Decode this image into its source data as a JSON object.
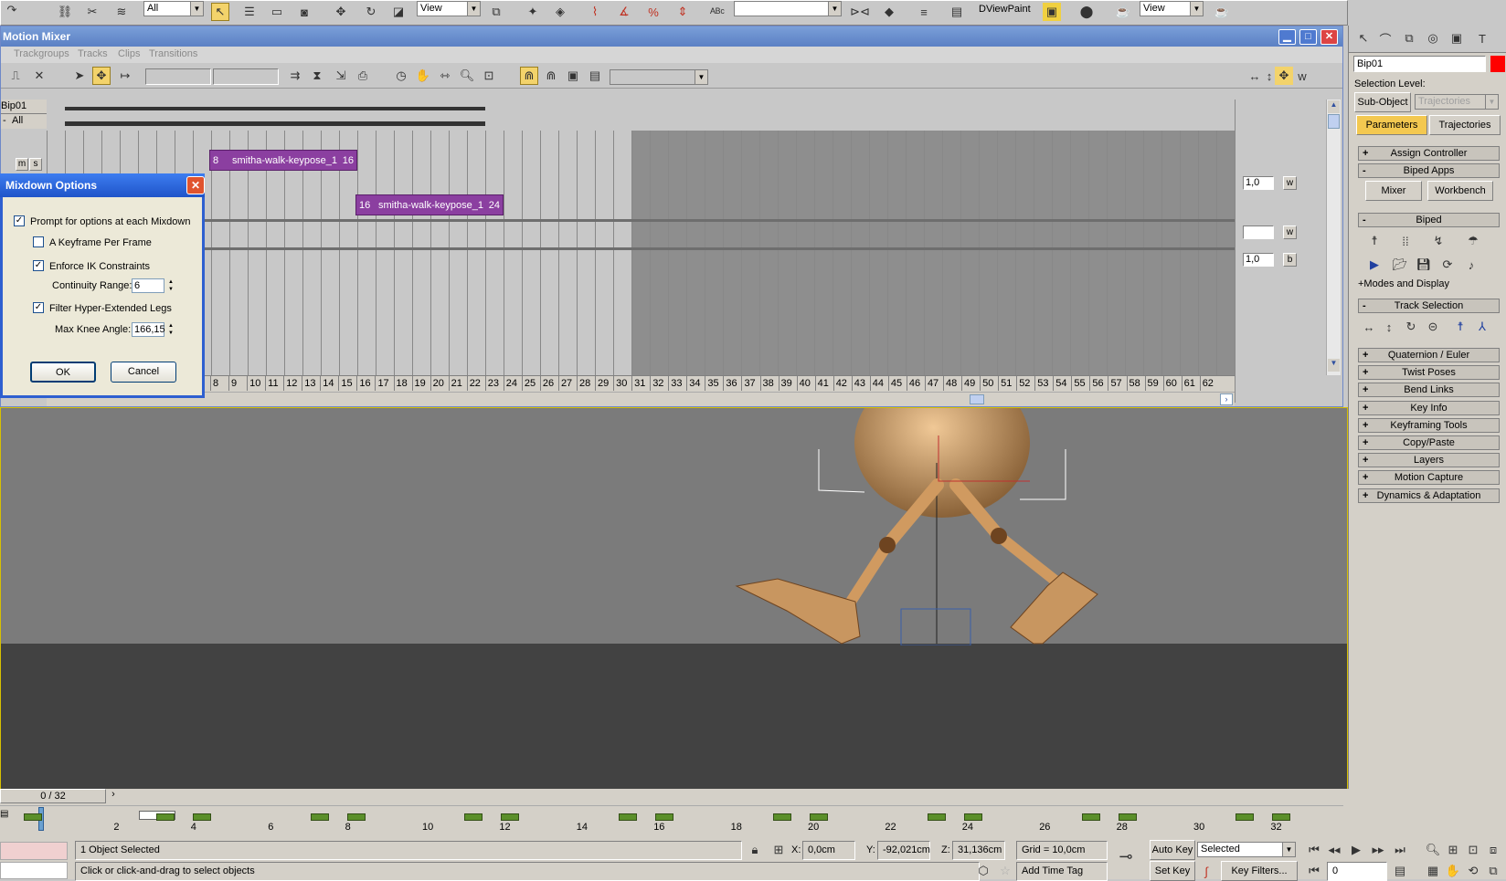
{
  "main_toolbar": {
    "selection_filter": "All",
    "view_dropdown_1": "View",
    "viewport_shading": "DViewPaint",
    "view_dropdown_2": "View"
  },
  "mixer": {
    "title": "Motion Mixer",
    "menu": [
      "Trackgroups",
      "Tracks",
      "Clips",
      "Transitions"
    ],
    "tracks": {
      "bip_label": "Bip01",
      "all_label": "All",
      "m_label": "m",
      "s_label": "s"
    },
    "clips": [
      {
        "start": "8",
        "name": "smitha-walk-keypose_1",
        "end": "16"
      },
      {
        "start": "16",
        "name": "smitha-walk-keypose_1",
        "end": "24"
      }
    ],
    "weights": [
      {
        "value": "1,0",
        "btn": "w"
      },
      {
        "value": "",
        "btn": "w"
      },
      {
        "value": "1,0",
        "btn": "b"
      }
    ],
    "ruler": [
      "8",
      "9",
      "10",
      "11",
      "12",
      "13",
      "14",
      "15",
      "16",
      "17",
      "18",
      "19",
      "20",
      "21",
      "22",
      "23",
      "24",
      "25",
      "26",
      "27",
      "28",
      "29",
      "30",
      "31",
      "32",
      "33",
      "34",
      "35",
      "36",
      "37",
      "38",
      "39",
      "40",
      "41",
      "42",
      "43",
      "44",
      "45",
      "46",
      "47",
      "48",
      "49",
      "50",
      "51",
      "52",
      "53",
      "54",
      "55",
      "56",
      "57",
      "58",
      "59",
      "60",
      "61",
      "62"
    ]
  },
  "dialog": {
    "title": "Mixdown Options",
    "prompt_label": "Prompt for options at each Mixdown",
    "keyframe_label": "A Keyframe Per Frame",
    "enforce_label": "Enforce IK Constraints",
    "continuity_label": "Continuity Range:",
    "continuity_value": "6",
    "filter_label": "Filter Hyper-Extended Legs",
    "knee_label": "Max Knee Angle:",
    "knee_value": "166,15",
    "ok_label": "OK",
    "cancel_label": "Cancel"
  },
  "command_panel": {
    "object_name": "Bip01",
    "object_color": "#ff0000",
    "selection_level_label": "Selection Level:",
    "sub_object_label": "Sub-Object",
    "trajectories_dropdown": "Trajectories",
    "tabs": [
      "Parameters",
      "Trajectories"
    ],
    "rollouts_top": [
      {
        "sign": "+",
        "label": "Assign Controller"
      },
      {
        "sign": "-",
        "label": "Biped Apps"
      }
    ],
    "biped_apps_buttons": [
      "Mixer",
      "Workbench"
    ],
    "biped_rollout": {
      "sign": "-",
      "label": "Biped"
    },
    "modes_label": "+Modes and Display",
    "track_selection": {
      "sign": "-",
      "label": "Track Selection"
    },
    "rollouts_bottom": [
      {
        "sign": "+",
        "label": "Quaternion / Euler"
      },
      {
        "sign": "+",
        "label": "Twist Poses"
      },
      {
        "sign": "+",
        "label": "Bend Links"
      },
      {
        "sign": "+",
        "label": "Key Info"
      },
      {
        "sign": "+",
        "label": "Keyframing Tools"
      },
      {
        "sign": "+",
        "label": "Copy/Paste"
      },
      {
        "sign": "+",
        "label": "Layers"
      },
      {
        "sign": "+",
        "label": "Motion Capture"
      },
      {
        "sign": "+",
        "label": "Dynamics & Adaptation"
      }
    ]
  },
  "timeline": {
    "slider_label": "0 / 32",
    "ticks": [
      "2",
      "4",
      "6",
      "8",
      "10",
      "12",
      "14",
      "16",
      "18",
      "20",
      "22",
      "24",
      "26",
      "28",
      "30",
      "32"
    ]
  },
  "status": {
    "selected": "1 Object Selected",
    "prompt": "Click or click-and-drag to select objects",
    "x_label": "X:",
    "x_value": "0,0cm",
    "y_label": "Y:",
    "y_value": "-92,021cm",
    "z_label": "Z:",
    "z_value": "31,136cm",
    "grid": "Grid = 10,0cm",
    "add_time_tag": "Add Time Tag",
    "auto_key": "Auto Key",
    "auto_key_dropdown": "Selected",
    "set_key": "Set Key",
    "key_filters": "Key Filters...",
    "frame_value": "0"
  }
}
